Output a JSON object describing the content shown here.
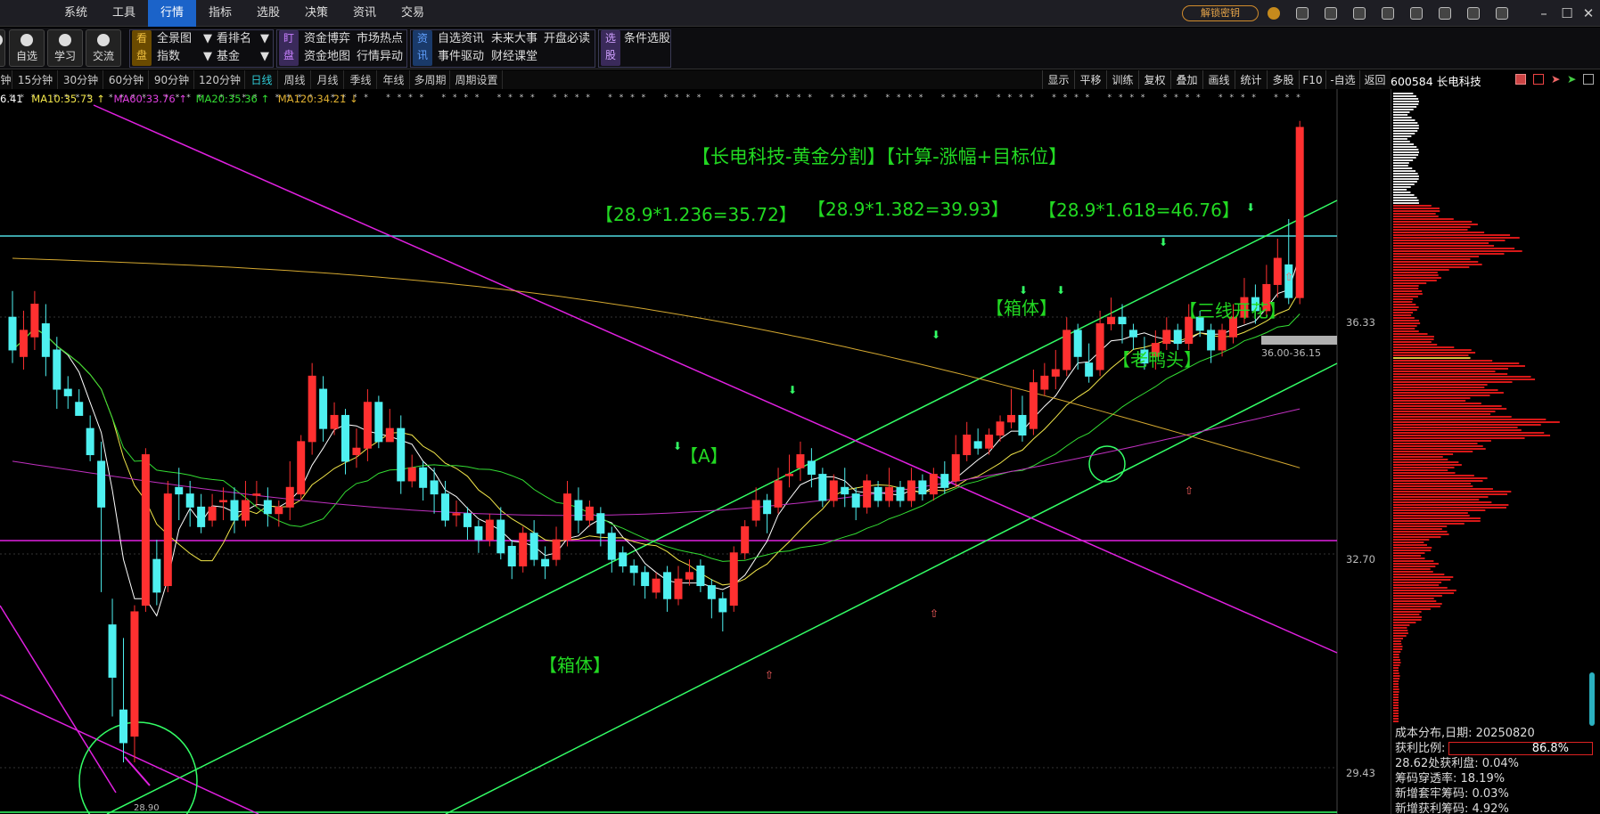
{
  "menubar": {
    "items": [
      "系统",
      "工具",
      "行情",
      "指标",
      "选股",
      "决策",
      "资讯",
      "交易"
    ],
    "active": "行情",
    "unlock_label": "解锁密钥"
  },
  "toolbar": {
    "partial_btn": "",
    "buttons": [
      "自选",
      "学习",
      "交流"
    ],
    "kanpan_tag": "看\n盘",
    "kanpan_items": [
      "全景图",
      "看排名",
      "指数",
      "基金"
    ],
    "dingpan_tag": "盯\n盘",
    "dingpan_items": [
      "资金博弈",
      "市场热点",
      "资金地图",
      "行情异动"
    ],
    "zixun_tag": "资\n讯",
    "zixun_items": [
      "自选资讯",
      "未来大事",
      "开盘必读",
      "事件驱动",
      "财经课堂"
    ],
    "xuangu_tag": "选\n股",
    "xuangu_items": [
      "条件选股"
    ]
  },
  "period_tabs": [
    "钟",
    "15分钟",
    "30分钟",
    "60分钟",
    "90分钟",
    "120分钟",
    "日线",
    "周线",
    "月线",
    "季线",
    "年线",
    "多周期",
    "周期设置"
  ],
  "active_period": "日线",
  "right_tabs": [
    "显示",
    "平移",
    "训练",
    "复权",
    "叠加",
    "画线",
    "统计",
    "多股",
    "F10",
    "-自选",
    "返回"
  ],
  "ticker": "600584 长电科技",
  "ma_legend": [
    {
      "label": "6.41",
      "color": "#ffffff"
    },
    {
      "label": "MA10:35.73 ↑",
      "color": "#f2e64a"
    },
    {
      "label": "MA60:33.76 ↑",
      "color": "#e040e0"
    },
    {
      "label": "MA20:35.36 ↑",
      "color": "#33dd33"
    },
    {
      "label": "MA120:34.21 ↓",
      "color": "#e0b030"
    }
  ],
  "price_axis": [
    "36.33",
    "32.70",
    "29.43"
  ],
  "price_levels": {
    "top_line": 36.33,
    "mid_line": 32.7,
    "chip_range": "36.00-36.15",
    "low_label": "28.90"
  },
  "annotations": {
    "title": "【长电科技-黄金分割】【计算-涨幅+目标位】",
    "fib1": "【28.9*1.236=35.72】",
    "fib2": "【28.9*1.382=39.93】",
    "fib3": "【28.9*1.618=46.76】",
    "box_top": "【箱体】",
    "three_line": "【三线开花】",
    "old_duck": "【老鸭头】",
    "a_mark": "【A】",
    "box_bottom": "【箱体】"
  },
  "chip_info": {
    "date_row": "成本分布,日期: 20250820",
    "profit_label": "获利比例:",
    "profit_value": "86.8%",
    "profit_ratio": 0.868,
    "row3": "28.62处获利盘: 0.04%",
    "row4": "筹码穿透率: 18.19%",
    "row5": "新增套牢筹码: 0.03%",
    "row6": "新增获利筹码: 4.92%"
  },
  "colors": {
    "up": "#ff3030",
    "down": "#4ef0f0",
    "magenta": "#e020e0",
    "green_line": "#33ff66",
    "cyan_line": "#4fd9e0",
    "ma5": "#ffffff",
    "ma10": "#f2e64a",
    "ma20": "#33dd33",
    "ma60": "#c030c0",
    "ma120": "#d4a830"
  },
  "chart_data": {
    "type": "candlestick",
    "title": "",
    "yaxis_labels": [
      "36.33",
      "32.70",
      "29.43"
    ],
    "candles": [
      [
        35.7,
        35.2,
        36.1,
        35.0
      ],
      [
        35.1,
        35.5,
        35.8,
        34.9
      ],
      [
        35.4,
        35.9,
        36.1,
        35.2
      ],
      [
        35.6,
        35.1,
        35.9,
        34.8
      ],
      [
        35.2,
        34.6,
        35.4,
        34.3
      ],
      [
        34.6,
        34.5,
        34.8,
        34.3
      ],
      [
        34.4,
        34.2,
        34.6,
        34.2
      ],
      [
        34.0,
        33.6,
        34.2,
        33.5
      ],
      [
        33.5,
        32.8,
        33.8,
        31.5
      ],
      [
        31.0,
        30.2,
        31.4,
        29.6
      ],
      [
        29.7,
        29.2,
        30.8,
        28.9
      ],
      [
        29.3,
        31.2,
        31.3,
        28.9
      ],
      [
        31.3,
        33.6,
        33.7,
        31.2
      ],
      [
        32.0,
        31.5,
        32.3,
        31.3
      ],
      [
        31.6,
        33.0,
        33.2,
        31.5
      ],
      [
        33.1,
        33.0,
        33.4,
        32.6
      ],
      [
        33.0,
        32.8,
        33.2,
        32.5
      ],
      [
        32.8,
        32.5,
        33.0,
        32.4
      ],
      [
        32.6,
        32.8,
        33.0,
        32.5
      ],
      [
        32.9,
        32.9,
        33.1,
        32.6
      ],
      [
        32.9,
        32.6,
        33.1,
        32.4
      ],
      [
        32.6,
        32.9,
        33.2,
        32.5
      ],
      [
        33.0,
        33.0,
        33.2,
        32.8
      ],
      [
        32.9,
        32.7,
        33.1,
        32.5
      ],
      [
        32.7,
        32.8,
        32.9,
        32.5
      ],
      [
        32.8,
        33.1,
        33.5,
        32.6
      ],
      [
        33.0,
        33.8,
        33.9,
        32.9
      ],
      [
        33.8,
        34.8,
        35.0,
        33.6
      ],
      [
        34.6,
        34.0,
        34.8,
        33.8
      ],
      [
        34.0,
        34.2,
        34.4,
        33.9
      ],
      [
        34.2,
        33.5,
        34.3,
        33.3
      ],
      [
        33.6,
        33.7,
        34.0,
        33.4
      ],
      [
        33.7,
        34.4,
        34.6,
        33.5
      ],
      [
        34.4,
        33.8,
        34.5,
        33.7
      ],
      [
        33.8,
        34.0,
        34.3,
        33.8
      ],
      [
        34.0,
        33.2,
        34.2,
        33.0
      ],
      [
        33.2,
        33.4,
        33.6,
        33.1
      ],
      [
        33.4,
        33.1,
        33.5,
        32.9
      ],
      [
        33.2,
        33.0,
        33.4,
        32.7
      ],
      [
        33.0,
        32.6,
        33.2,
        32.5
      ],
      [
        32.7,
        32.7,
        32.9,
        32.5
      ],
      [
        32.7,
        32.5,
        32.8,
        32.3
      ],
      [
        32.5,
        32.3,
        32.6,
        32.1
      ],
      [
        32.3,
        32.6,
        32.7,
        32.2
      ],
      [
        32.6,
        32.1,
        32.8,
        32.0
      ],
      [
        32.2,
        31.9,
        32.3,
        31.7
      ],
      [
        31.9,
        32.4,
        32.5,
        31.8
      ],
      [
        32.4,
        32.0,
        32.6,
        31.9
      ],
      [
        32.0,
        31.9,
        32.2,
        31.7
      ],
      [
        32.0,
        32.3,
        32.5,
        31.9
      ],
      [
        32.3,
        33.0,
        33.2,
        32.2
      ],
      [
        32.9,
        32.6,
        33.1,
        32.4
      ],
      [
        32.6,
        32.8,
        32.9,
        32.5
      ],
      [
        32.7,
        32.4,
        32.8,
        32.2
      ],
      [
        32.4,
        32.0,
        32.5,
        31.8
      ],
      [
        32.1,
        31.9,
        32.2,
        31.8
      ],
      [
        31.9,
        31.8,
        32.0,
        31.6
      ],
      [
        31.8,
        31.6,
        31.9,
        31.4
      ],
      [
        31.5,
        31.7,
        31.8,
        31.4
      ],
      [
        31.8,
        31.4,
        31.9,
        31.2
      ],
      [
        31.4,
        31.7,
        31.9,
        31.3
      ],
      [
        31.7,
        31.8,
        32.0,
        31.6
      ],
      [
        31.9,
        31.6,
        32.0,
        31.5
      ],
      [
        31.6,
        31.4,
        31.7,
        31.1
      ],
      [
        31.4,
        31.2,
        31.5,
        30.9
      ],
      [
        31.3,
        32.1,
        32.2,
        31.2
      ],
      [
        32.1,
        32.5,
        32.6,
        32.0
      ],
      [
        32.6,
        32.9,
        33.1,
        32.5
      ],
      [
        32.9,
        32.7,
        33.0,
        32.4
      ],
      [
        32.8,
        33.2,
        33.4,
        32.7
      ],
      [
        33.3,
        33.3,
        33.6,
        33.1
      ],
      [
        33.4,
        33.6,
        33.8,
        33.2
      ],
      [
        33.5,
        33.3,
        33.7,
        33.1
      ],
      [
        33.3,
        32.9,
        33.4,
        32.8
      ],
      [
        32.9,
        33.2,
        33.3,
        32.8
      ],
      [
        33.1,
        33.0,
        33.4,
        32.8
      ],
      [
        33.0,
        32.8,
        33.1,
        32.6
      ],
      [
        32.8,
        33.2,
        33.3,
        32.7
      ],
      [
        33.1,
        32.9,
        33.2,
        32.8
      ],
      [
        32.9,
        33.1,
        33.4,
        32.8
      ],
      [
        33.1,
        32.9,
        33.2,
        32.8
      ],
      [
        32.9,
        33.2,
        33.4,
        32.8
      ],
      [
        33.2,
        33.0,
        33.3,
        32.9
      ],
      [
        33.0,
        33.3,
        33.4,
        32.9
      ],
      [
        33.3,
        33.1,
        33.5,
        33.0
      ],
      [
        33.2,
        33.6,
        33.9,
        33.1
      ],
      [
        33.6,
        33.9,
        34.1,
        33.5
      ],
      [
        33.8,
        33.7,
        34.0,
        33.6
      ],
      [
        33.7,
        33.9,
        34.0,
        33.6
      ],
      [
        33.9,
        34.1,
        34.2,
        33.8
      ],
      [
        34.1,
        34.2,
        34.6,
        34.0
      ],
      [
        34.2,
        33.9,
        34.5,
        33.8
      ],
      [
        34.0,
        34.7,
        34.9,
        33.9
      ],
      [
        34.6,
        34.8,
        35.0,
        34.5
      ],
      [
        34.8,
        34.9,
        35.2,
        34.6
      ],
      [
        34.9,
        35.5,
        35.7,
        34.8
      ],
      [
        35.5,
        35.1,
        35.6,
        34.9
      ],
      [
        35.0,
        34.8,
        35.3,
        34.7
      ],
      [
        34.9,
        35.6,
        35.8,
        34.8
      ],
      [
        35.6,
        35.7,
        36.0,
        35.5
      ],
      [
        35.7,
        35.6,
        35.9,
        35.3
      ],
      [
        35.5,
        35.4,
        35.6,
        35.2
      ],
      [
        35.2,
        35.0,
        35.4,
        34.9
      ],
      [
        35.1,
        35.3,
        35.5,
        34.9
      ],
      [
        35.3,
        35.5,
        35.7,
        35.2
      ],
      [
        35.5,
        35.3,
        35.6,
        35.2
      ],
      [
        35.3,
        35.7,
        35.9,
        35.2
      ],
      [
        35.7,
        35.5,
        35.8,
        35.4
      ],
      [
        35.5,
        35.2,
        35.6,
        35.0
      ],
      [
        35.2,
        35.5,
        35.6,
        35.1
      ],
      [
        35.4,
        35.7,
        35.9,
        35.3
      ],
      [
        35.7,
        36.0,
        36.3,
        35.6
      ],
      [
        36.0,
        35.8,
        36.2,
        35.6
      ],
      [
        35.8,
        36.2,
        36.5,
        35.7
      ],
      [
        36.2,
        36.6,
        36.9,
        36.0
      ],
      [
        36.5,
        36.0,
        37.2,
        35.9
      ],
      [
        36.0,
        38.6,
        38.7,
        35.9
      ]
    ]
  }
}
